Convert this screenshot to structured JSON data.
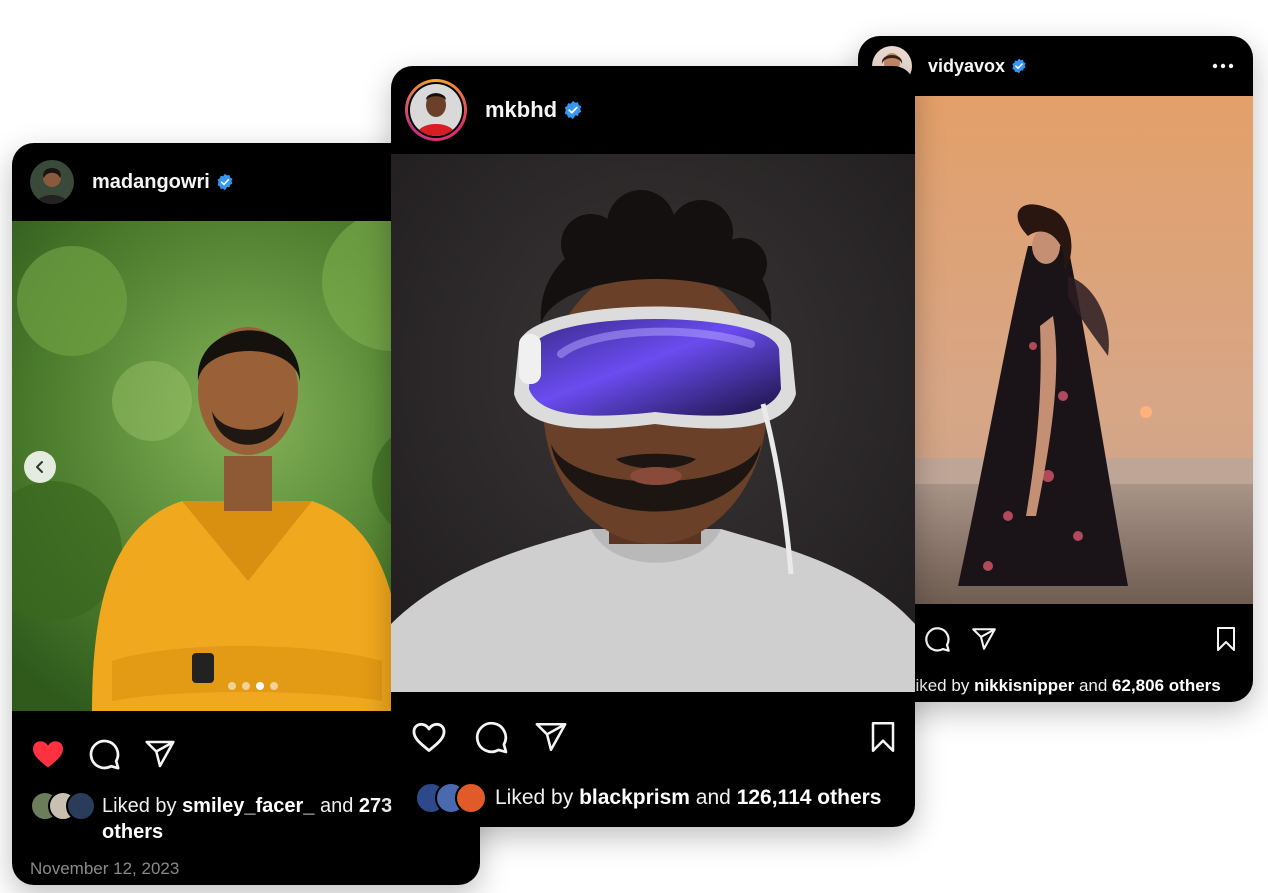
{
  "posts": [
    {
      "username": "madangowri",
      "liked_by_prefix": "Liked by",
      "liked_by_user": "smiley_facer_",
      "liked_and": "and",
      "liked_count": "273",
      "liked_suffix": "others",
      "date": "November 12, 2023",
      "liked": true,
      "carousel_active_index": 2,
      "carousel_count": 4
    },
    {
      "username": "mkbhd",
      "liked_by_prefix": "Liked by",
      "liked_by_user": "blackprism",
      "liked_and": "and",
      "liked_count": "126,114",
      "liked_suffix": "others",
      "liked": false
    },
    {
      "username": "vidyavox",
      "liked_by_prefix": "Liked by",
      "liked_by_user": "nikkisnipper",
      "liked_and": "and",
      "liked_count": "62,806",
      "liked_suffix": "others",
      "liked": true
    }
  ],
  "colors": {
    "card_bg": "#000000",
    "verified_blue": "#3797f0",
    "like_red": "#ff3040",
    "muted_text": "#8a8a8a"
  },
  "icons": [
    "heart-icon",
    "comment-icon",
    "share-icon",
    "bookmark-icon",
    "verified-badge-icon",
    "more-options-icon",
    "chevron-left-icon",
    "user-tag-icon"
  ]
}
